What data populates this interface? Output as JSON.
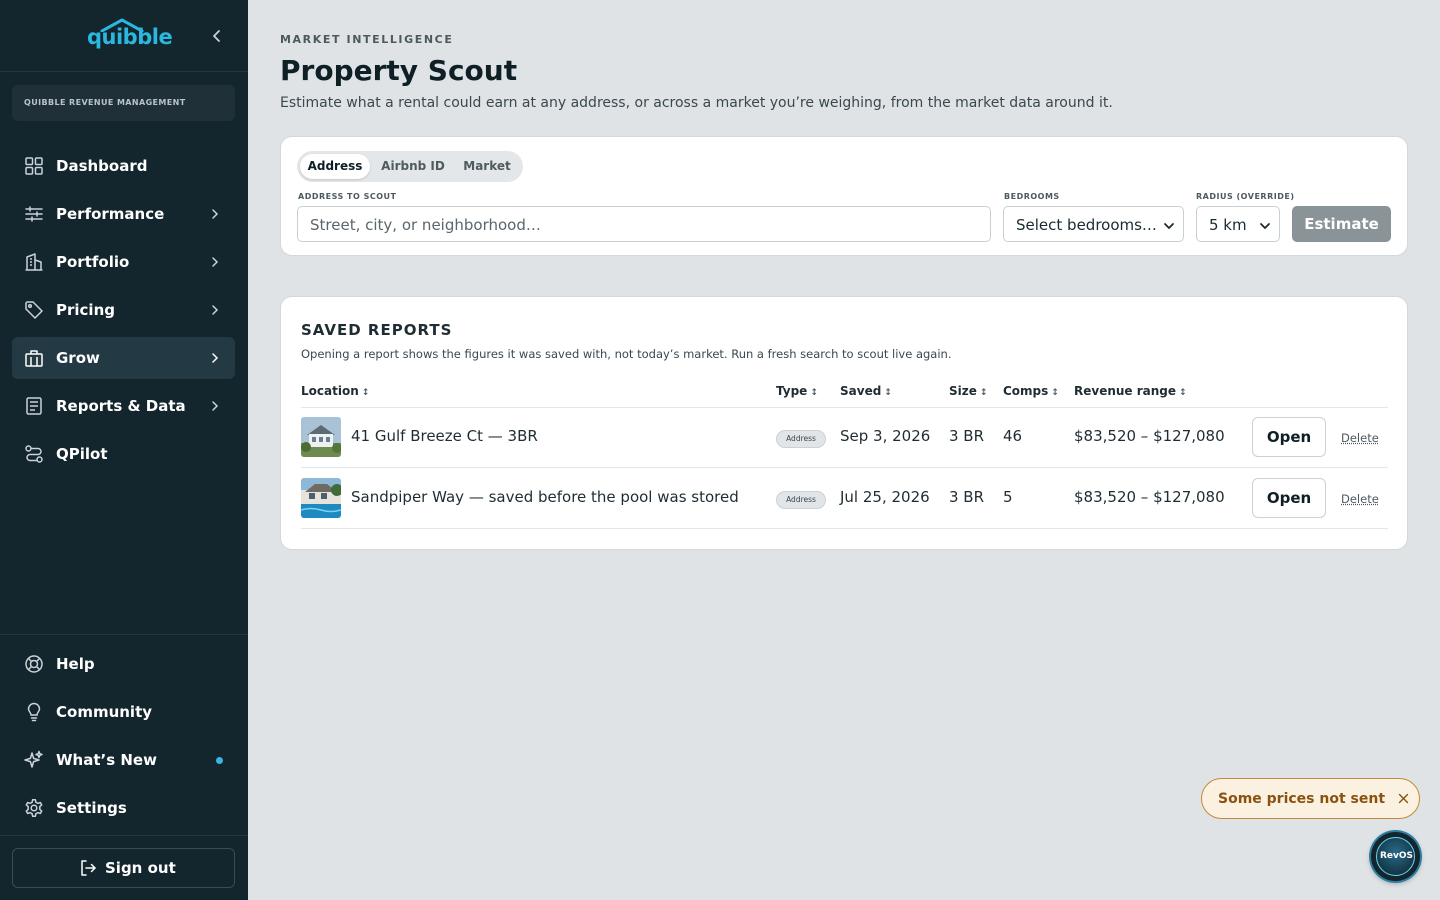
{
  "brand": {
    "logo_text": "quibble",
    "accent": "#2bb8e0",
    "sidebar_bg": "#13252d"
  },
  "sidebar": {
    "org_name": "QUIBBLE REVENUE MANAGEMENT",
    "items": [
      {
        "label": "Dashboard",
        "icon": "grid-icon",
        "has_children": false
      },
      {
        "label": "Performance",
        "icon": "sliders-icon",
        "has_children": true
      },
      {
        "label": "Portfolio",
        "icon": "building-icon",
        "has_children": true
      },
      {
        "label": "Pricing",
        "icon": "tag-icon",
        "has_children": true
      },
      {
        "label": "Grow",
        "icon": "storefront-icon",
        "has_children": true,
        "active": true
      },
      {
        "label": "Reports & Data",
        "icon": "document-icon",
        "has_children": true
      },
      {
        "label": "QPilot",
        "icon": "route-icon",
        "has_children": false
      }
    ],
    "footer_items": [
      {
        "label": "Help",
        "icon": "lifebuoy-icon"
      },
      {
        "label": "Community",
        "icon": "lightbulb-icon"
      },
      {
        "label": "What’s New",
        "icon": "sparkle-icon",
        "dot": true
      },
      {
        "label": "Settings",
        "icon": "gear-icon"
      }
    ],
    "signout_label": "Sign out"
  },
  "header": {
    "eyebrow": "MARKET INTELLIGENCE",
    "title": "Property Scout",
    "subtitle": "Estimate what a rental could earn at any address, or across a market you’re weighing, from the market data around it."
  },
  "search": {
    "tabs": [
      {
        "label": "Address",
        "selected": true
      },
      {
        "label": "Airbnb ID",
        "selected": false
      },
      {
        "label": "Market",
        "selected": false
      }
    ],
    "address_label": "ADDRESS TO SCOUT",
    "address_placeholder": "Street, city, or neighborhood…",
    "bedrooms_label": "BEDROOMS",
    "bedrooms_value": "Select bedrooms…",
    "radius_label": "RADIUS (OVERRIDE)",
    "radius_value": "5 km",
    "estimate_label": "Estimate"
  },
  "reports": {
    "title": "SAVED REPORTS",
    "subtitle": "Opening a report shows the figures it was saved with, not today’s market. Run a fresh search to scout live again.",
    "columns": [
      "Location",
      "Type",
      "Saved",
      "Size",
      "Comps",
      "Revenue range"
    ],
    "sort_glyph": "↕",
    "rows": [
      {
        "location": "41 Gulf Breeze Ct — 3BR",
        "type": "Address",
        "saved": "Sep 3, 2026",
        "size": "3 BR",
        "comps": "46",
        "revenue": "$83,520 – $127,080",
        "open": "Open",
        "delete": "Delete"
      },
      {
        "location": "Sandpiper Way — saved before the pool was stored",
        "type": "Address",
        "saved": "Jul 25, 2026",
        "size": "3 BR",
        "comps": "5",
        "revenue": "$83,520 – $127,080",
        "open": "Open",
        "delete": "Delete"
      }
    ]
  },
  "toast": {
    "text": "Some prices not sent",
    "color": "#8a5210"
  },
  "assistant": {
    "label": "RevOS"
  }
}
